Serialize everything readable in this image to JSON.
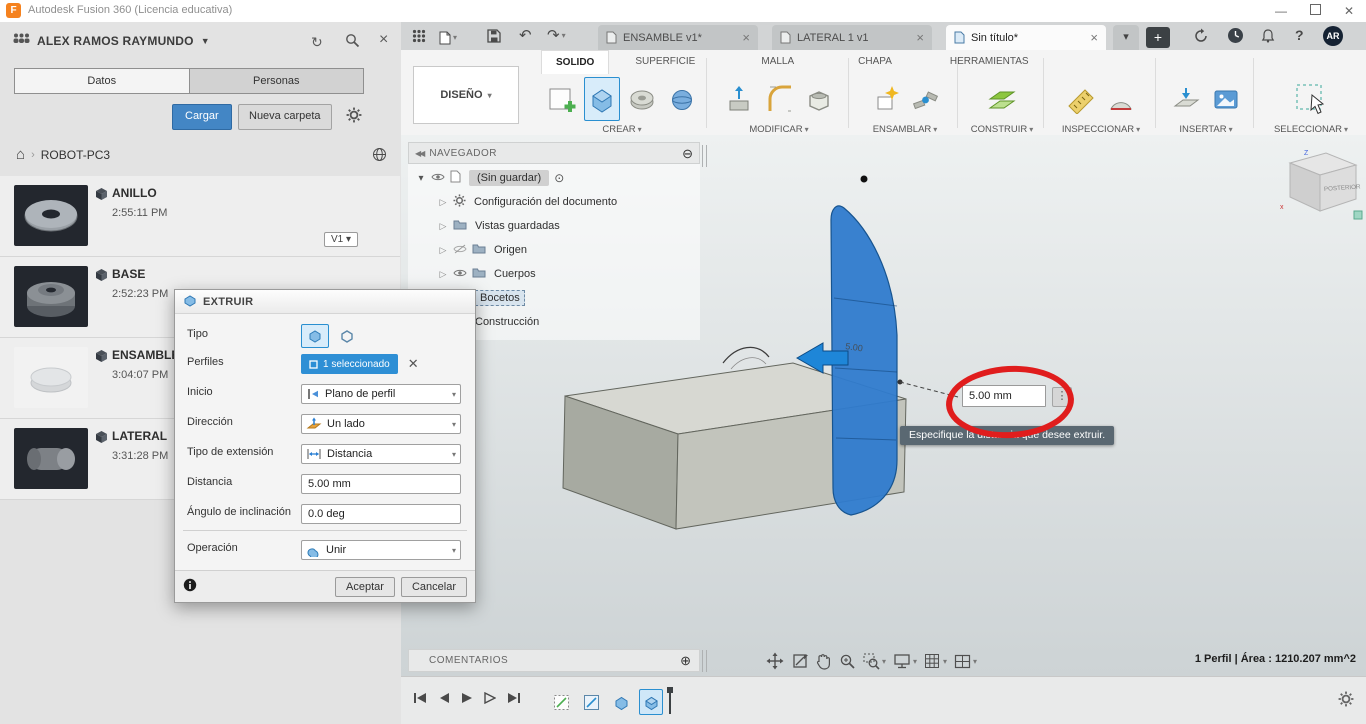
{
  "titlebar": {
    "app_title": "Autodesk Fusion 360 (Licencia educativa)"
  },
  "data_panel": {
    "user_name": "ALEX RAMOS RAYMUNDO",
    "tab_datos": "Datos",
    "tab_personas": "Personas",
    "upload_button": "Cargar",
    "new_folder_button": "Nueva carpeta",
    "breadcrumb_root": "ROBOT-PC3",
    "items": [
      {
        "name": "ANILLO",
        "time": "2:55:11 PM",
        "version": "V1"
      },
      {
        "name": "BASE",
        "time": "2:52:23 PM"
      },
      {
        "name": "ENSAMBLE",
        "time": "3:04:07 PM"
      },
      {
        "name": "LATERAL",
        "time": "3:31:28 PM"
      }
    ]
  },
  "doc_bar": {
    "tabs": [
      {
        "label": "ENSAMBLE v1*"
      },
      {
        "label": "LATERAL 1 v1"
      },
      {
        "label": "Sin título*"
      }
    ],
    "avatar_initials": "AR"
  },
  "ribbon": {
    "workspace_selector": "DISEÑO",
    "tabs": [
      "SOLIDO",
      "SUPERFICIE",
      "MALLA",
      "CHAPA",
      "HERRAMIENTAS"
    ],
    "groups": [
      "CREAR",
      "MODIFICAR",
      "ENSAMBLAR",
      "CONSTRUIR",
      "INSPECCIONAR",
      "INSERTAR",
      "SELECCIONAR"
    ]
  },
  "navigator": {
    "title": "NAVEGADOR",
    "root_label": "(Sin guardar)",
    "items": [
      "Configuración del documento",
      "Vistas guardadas",
      "Origen",
      "Cuerpos",
      "Bocetos",
      "Construcción"
    ]
  },
  "extrude_dialog": {
    "title": "EXTRUIR",
    "labels": {
      "tipo": "Tipo",
      "perfiles": "Perfiles",
      "inicio": "Inicio",
      "direccion": "Dirección",
      "extension": "Tipo de extensión",
      "distancia": "Distancia",
      "angulo": "Ángulo de inclinación",
      "operacion": "Operación"
    },
    "values": {
      "perfiles": "1 seleccionado",
      "inicio": "Plano de perfil",
      "direccion": "Un lado",
      "extension": "Distancia",
      "distancia": "5.00 mm",
      "angulo": "0.0 deg",
      "operacion": "Unir"
    },
    "accept_button": "Aceptar",
    "cancel_button": "Cancelar"
  },
  "viewport": {
    "distance_input": "5.00 mm",
    "distance_ghost_label": "5.00",
    "tooltip": "Especifique la distancia que desee extruir.",
    "viewcube_face": "POSTERIOR",
    "status_text": "1 Perfil | Área : 1210.207 mm^2"
  },
  "comments_panel": {
    "title": "COMENTARIOS"
  }
}
